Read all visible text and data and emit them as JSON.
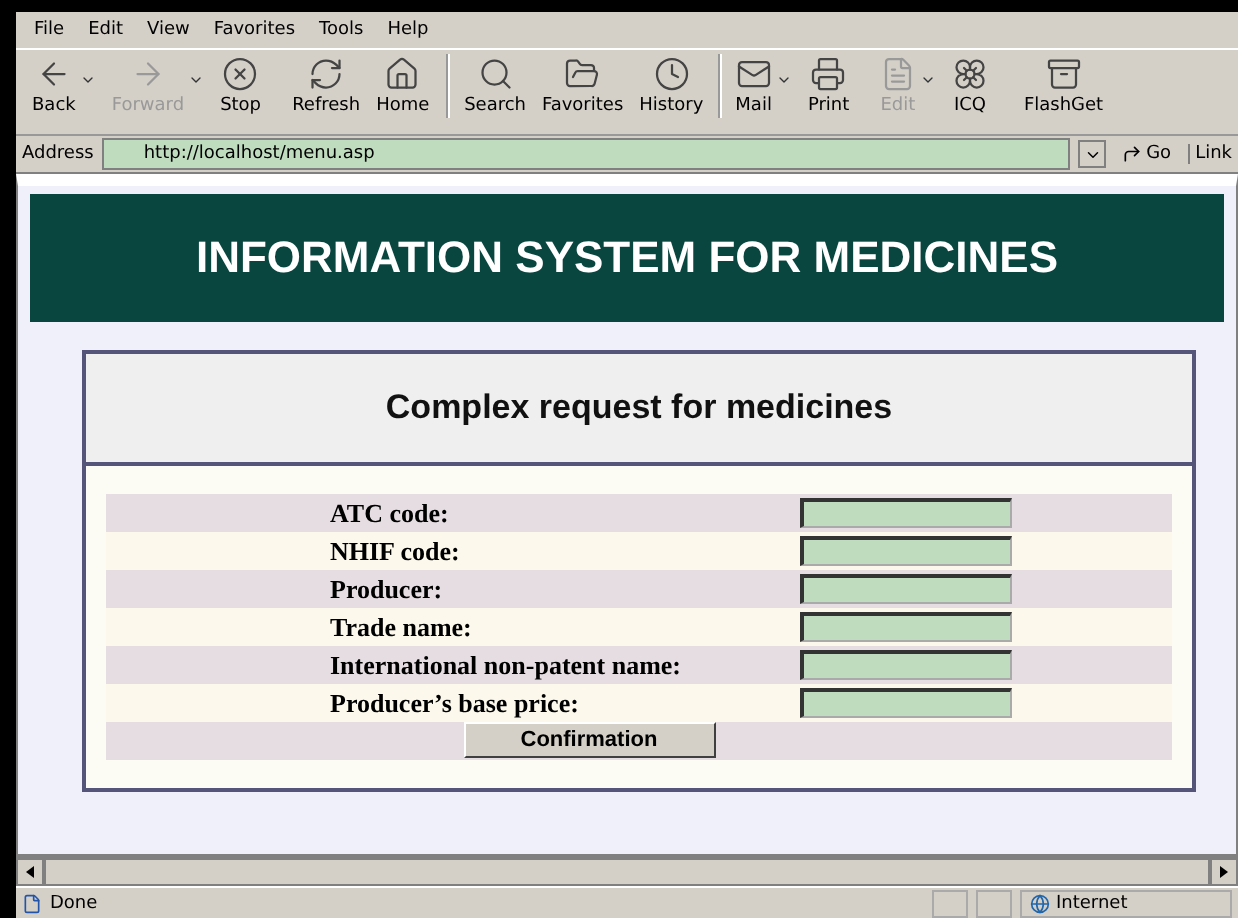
{
  "menu": [
    "File",
    "Edit",
    "View",
    "Favorites",
    "Tools",
    "Help"
  ],
  "toolbar_groups": [
    [
      {
        "label": "Back",
        "disabled": false,
        "dropdown": true
      },
      {
        "label": "Forward",
        "disabled": true,
        "dropdown": true
      },
      {
        "label": "Stop",
        "disabled": false,
        "dropdown": false
      },
      {
        "label": "Refresh",
        "disabled": false,
        "dropdown": false
      },
      {
        "label": "Home",
        "disabled": false,
        "dropdown": false
      }
    ],
    [
      {
        "label": "Search",
        "disabled": false,
        "dropdown": false
      },
      {
        "label": "Favorites",
        "disabled": false,
        "dropdown": false
      },
      {
        "label": "History",
        "disabled": false,
        "dropdown": false
      }
    ],
    [
      {
        "label": "Mail",
        "disabled": false,
        "dropdown": true
      },
      {
        "label": "Print",
        "disabled": false,
        "dropdown": false
      },
      {
        "label": "Edit",
        "disabled": true,
        "dropdown": true
      },
      {
        "label": "ICQ",
        "disabled": false,
        "dropdown": false
      },
      {
        "label": "FlashGet",
        "disabled": false,
        "dropdown": false
      }
    ]
  ],
  "address": {
    "label": "Address",
    "url": "http://localhost/menu.asp",
    "go": "Go",
    "links": "Link"
  },
  "page": {
    "header": "INFORMATION SYSTEM FOR MEDICINES",
    "form_title": "Complex request for medicines",
    "fields": [
      {
        "label": "ATC code:"
      },
      {
        "label": "NHIF code:"
      },
      {
        "label": "Producer:"
      },
      {
        "label": "Trade name:"
      },
      {
        "label": "International non-patent name:"
      },
      {
        "label": "Producer’s base price:"
      }
    ],
    "submit": "Confirmation"
  },
  "status_bar": {
    "text": "Done",
    "zone": "Internet"
  }
}
